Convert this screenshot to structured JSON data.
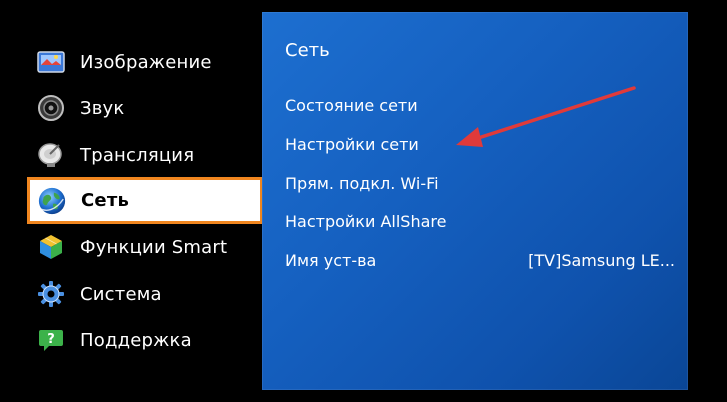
{
  "sidebar": {
    "items": [
      {
        "label": "Изображение",
        "icon": "picture-icon"
      },
      {
        "label": "Звук",
        "icon": "speaker-icon"
      },
      {
        "label": "Трансляция",
        "icon": "satellite-dish-icon"
      },
      {
        "label": "Сеть",
        "icon": "globe-icon",
        "selected": true
      },
      {
        "label": "Функции Smart",
        "icon": "smart-cube-icon"
      },
      {
        "label": "Система",
        "icon": "gear-icon"
      },
      {
        "label": "Поддержка",
        "icon": "help-chat-icon"
      }
    ]
  },
  "panel": {
    "title": "Сеть",
    "rows": [
      {
        "label": "Состояние сети"
      },
      {
        "label": "Настройки сети"
      },
      {
        "label": "Прям. подкл. Wi-Fi"
      },
      {
        "label": "Настройки AllShare"
      },
      {
        "label": "Имя уст-ва",
        "value": "[TV]Samsung LE..."
      }
    ]
  },
  "colors": {
    "panel_blue": "#1560c0",
    "selection_border": "#f0861f",
    "annotation_arrow": "#e03a3a"
  }
}
